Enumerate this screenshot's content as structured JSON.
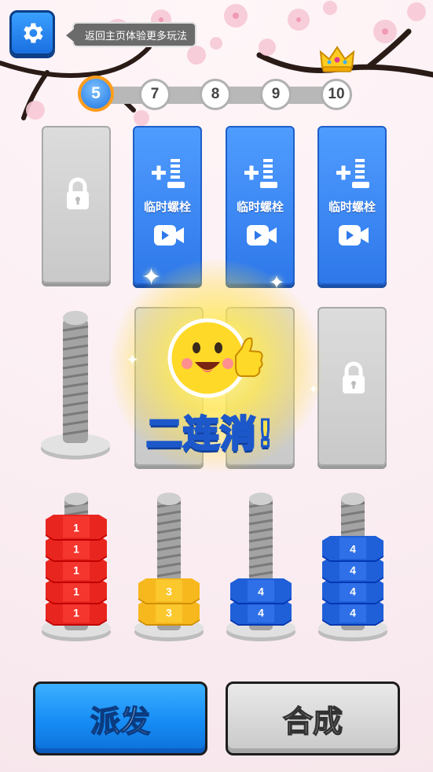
{
  "top_bar": {
    "settings_icon": "gear-icon",
    "hint_text": "返回主页体验更多玩法",
    "crown_icon": "crown-icon"
  },
  "levels": [
    "5",
    "7",
    "8",
    "9",
    "10"
  ],
  "current_level": "5",
  "slots": {
    "locked_icon": "padlock-icon",
    "temp_bolt_label": "临时螺栓",
    "temp_bolt_icon": "add-bolt-icon",
    "video_icon": "video-camera-icon"
  },
  "combo_text": "二连消!",
  "bolts": [
    {
      "color": "#e8261f",
      "nuts": [
        "1",
        "1",
        "1",
        "1",
        "1"
      ]
    },
    {
      "color": "#f7b81e",
      "nuts": [
        "3",
        "3"
      ]
    },
    {
      "color": "#1f5fd8",
      "nuts": [
        "4",
        "4"
      ]
    },
    {
      "color": "#1f5fd8",
      "nuts": [
        "4",
        "4",
        "4",
        "4"
      ]
    }
  ],
  "buttons": {
    "dispatch": "派发",
    "merge": "合成"
  }
}
